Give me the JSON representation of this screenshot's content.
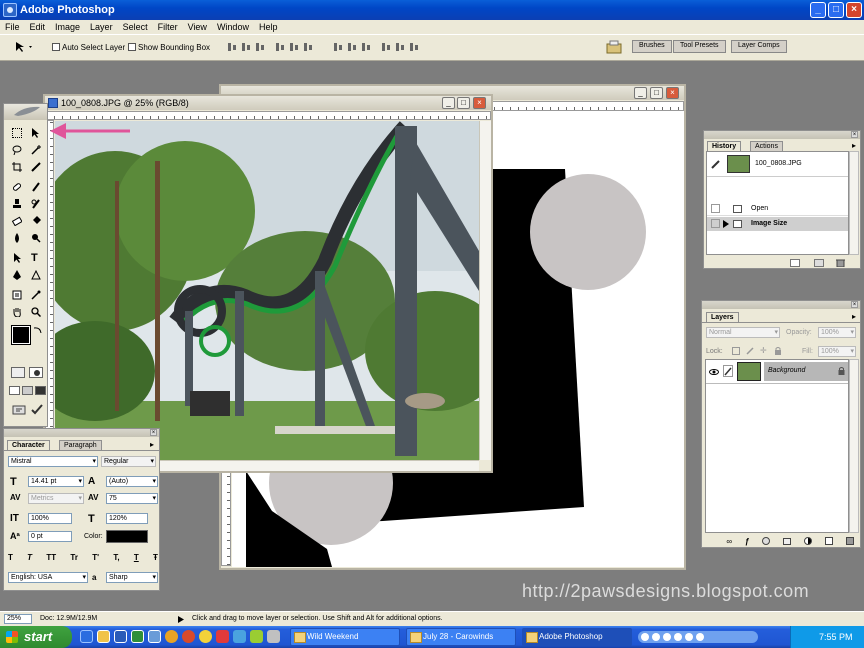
{
  "window": {
    "title": "Adobe Photoshop"
  },
  "menu": [
    "File",
    "Edit",
    "Image",
    "Layer",
    "Select",
    "Filter",
    "View",
    "Window",
    "Help"
  ],
  "options": {
    "auto_select": "Auto Select Layer",
    "show_bbox": "Show Bounding Box",
    "wells": [
      "Brushes",
      "Tool Presets",
      "Layer Comps"
    ]
  },
  "document": {
    "title": "100_0808.JPG @ 25% (RGB/8)"
  },
  "character": {
    "tabs": [
      "Character",
      "Paragraph"
    ],
    "font": "Mistral",
    "style": "Regular",
    "size": "14.41 pt",
    "leading": "(Auto)",
    "kerning": "Metrics",
    "tracking": "75",
    "vscale": "100%",
    "hscale": "120%",
    "baseline": "0 pt",
    "color_label": "Color:",
    "language": "English: USA",
    "aa_label": "a",
    "aa": "Sharp",
    "type_buttons": [
      "T",
      "T",
      "TT",
      "Tr",
      "T'",
      "T,",
      "T",
      "Ŧ"
    ]
  },
  "history": {
    "tabs": [
      "History",
      "Actions"
    ],
    "snapshot": "100_0808.JPG",
    "items": [
      "Open",
      "Image Size"
    ]
  },
  "layers": {
    "tab": "Layers",
    "blend": "Normal",
    "opacity_label": "Opacity:",
    "opacity": "100%",
    "lock_label": "Lock:",
    "fill_label": "Fill:",
    "fill": "100%",
    "layer_name": "Background"
  },
  "status": {
    "zoom": "25%",
    "doc": "Doc: 12.9M/12.9M",
    "hint": "Click and drag to move layer or selection.  Use Shift and Alt for additional options."
  },
  "watermark": "http://2pawsdesigns.blogspot.com",
  "taskbar": {
    "start": "start",
    "buttons": [
      "Wild Weekend",
      "July 28 - Carowinds",
      "Adobe Photoshop"
    ],
    "clock": "7:55 PM"
  },
  "colors": {
    "accent": "#e0559a",
    "circle": "#c8c4c4",
    "track_green": "#1f9a3a",
    "steel": "#4b545c"
  }
}
